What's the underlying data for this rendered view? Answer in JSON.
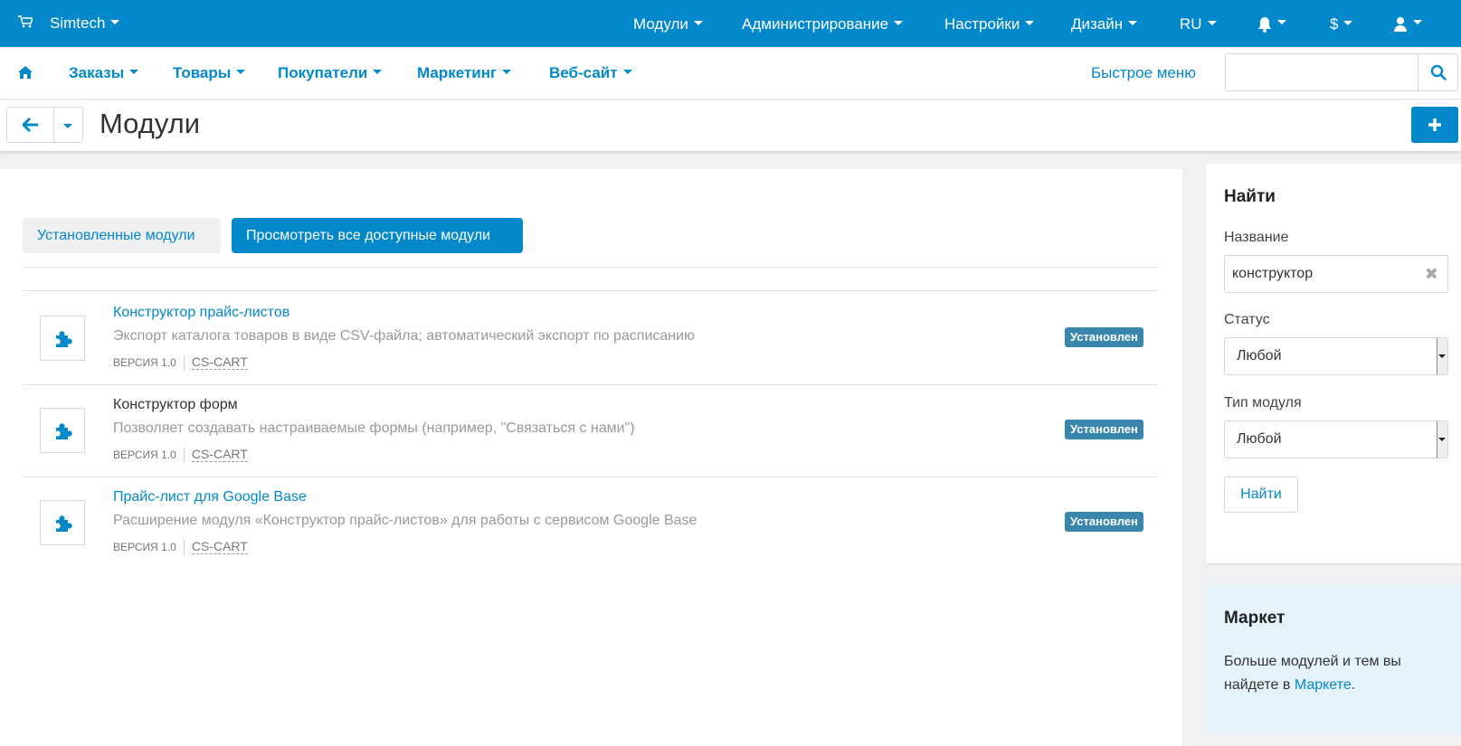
{
  "topbar": {
    "store": "Simtech",
    "nav": [
      "Модули",
      "Администрирование",
      "Настройки",
      "Дизайн",
      "RU",
      "$"
    ]
  },
  "subnav": {
    "items": [
      "Заказы",
      "Товары",
      "Покупатели",
      "Маркетинг",
      "Веб-сайт"
    ],
    "quick_menu": "Быстрое меню",
    "search_placeholder": ""
  },
  "page": {
    "title": "Модули"
  },
  "tabs": {
    "installed": "Установленные модули",
    "all": "Просмотреть все доступные модули"
  },
  "modules": [
    {
      "name": "Конструктор прайс-листов",
      "description": "Экспорт каталога товаров в виде CSV-файла; автоматический экспорт по расписанию",
      "version": "ВЕРСИЯ 1.0",
      "vendor": "CS-CART",
      "status": "Установлен"
    },
    {
      "name": "Конструктор форм",
      "description": "Позволяет создавать настраиваемые формы (например, \"Связаться с нами\")",
      "version": "ВЕРСИЯ 1.0",
      "vendor": "CS-CART",
      "status": "Установлен"
    },
    {
      "name": "Прайс-лист для Google Base",
      "description": "Расширение модуля «Конструктор прайс-листов» для работы с сервисом Google Base",
      "version": "ВЕРСИЯ 1.0",
      "vendor": "CS-CART",
      "status": "Установлен"
    }
  ],
  "filter": {
    "title": "Найти",
    "name_label": "Название",
    "name_value": "конструктор",
    "status_label": "Статус",
    "status_value": "Любой",
    "type_label": "Тип модуля",
    "type_value": "Любой",
    "submit": "Найти"
  },
  "market": {
    "title": "Маркет",
    "text": "Больше модулей и тем вы найдете в ",
    "link": "Маркете",
    "suffix": "."
  },
  "colors": {
    "primary": "#0388cc",
    "badge": "#3a87ad",
    "market_bg": "#e4f3fc"
  }
}
